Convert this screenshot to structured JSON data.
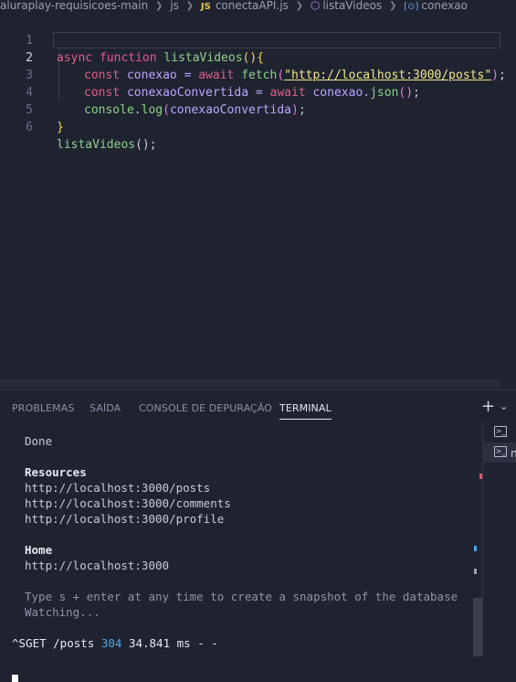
{
  "breadcrumb": {
    "items": [
      "aluraplay-requisicoes-main",
      "js",
      "conectaAPI.js",
      "listaVideos",
      "conexao"
    ],
    "js_badge": "JS"
  },
  "editor": {
    "line_numbers": [
      "1",
      "2",
      "3",
      "4",
      "5",
      "6"
    ],
    "active_line": 2,
    "lines": [
      {
        "tokens": [
          "async",
          " ",
          "function",
          " ",
          "listaVideos",
          "()",
          "{"
        ]
      },
      {
        "tokens": [
          "const",
          " conexao = ",
          "await",
          " ",
          "fetch",
          "(",
          "\"http://localhost:3000/posts\"",
          ")",
          ";"
        ]
      },
      {
        "tokens": [
          "const",
          " conexaoConvertida = ",
          "await",
          " conexao.",
          "json",
          "()",
          ";"
        ]
      },
      {
        "tokens": [
          "console",
          ".",
          "log",
          "(",
          "conexaoConvertida",
          ")",
          ";"
        ]
      },
      {
        "tokens": [
          "}"
        ]
      },
      {
        "tokens": [
          "listaVideos",
          "();"
        ]
      }
    ]
  },
  "panel": {
    "tabs": [
      "PROBLEMAS",
      "SAÍDA",
      "CONSOLE DE DEPURAÇÃO",
      "TERMINAL"
    ],
    "active_tab": "TERMINAL",
    "add_label": "+",
    "chevron_label": "⌄"
  },
  "terminal": {
    "done": "Done",
    "resources_heading": "Resources",
    "resources": [
      "http://localhost:3000/posts",
      "http://localhost:3000/comments",
      "http://localhost:3000/profile"
    ],
    "home_heading": "Home",
    "home_url": "http://localhost:3000",
    "hint": "Type s + enter at any time to create a snapshot of the database",
    "watching": "Watching...",
    "request_prefix": "^SGET /posts ",
    "request_status": "304",
    "request_suffix": " 34.841 ms - -"
  },
  "side": {
    "label": "n",
    "icons": [
      "terminal-icon",
      "terminal-icon"
    ]
  },
  "colors": {
    "background": "#1f2330",
    "keyword": "#e35d8e",
    "function": "#8fd18a",
    "string": "#f0e68c",
    "status_code": "#4ea8e6"
  }
}
